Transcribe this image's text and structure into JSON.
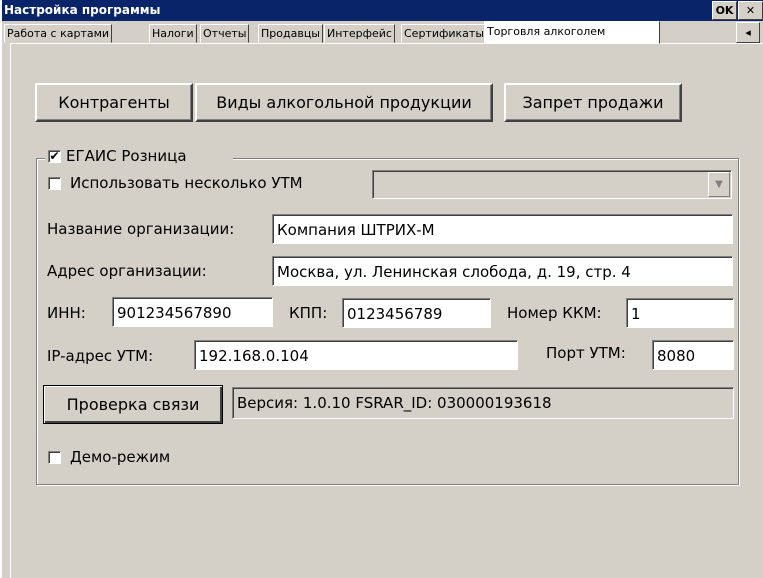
{
  "window": {
    "title": "Настройка программы",
    "ok_label": "OK",
    "close_label": "✕"
  },
  "tabs": [
    {
      "label": "Работа с картами",
      "active": false
    },
    {
      "label": "Налоги",
      "active": false
    },
    {
      "label": "Отчеты",
      "active": false
    },
    {
      "label": "Продавцы",
      "active": false
    },
    {
      "label": "Интерфейс",
      "active": false
    },
    {
      "label": "Сертификаты",
      "active": false
    },
    {
      "label": "Торговля алкоголем",
      "active": true
    }
  ],
  "tab_scroll_left_icon": "◂",
  "buttons": {
    "contractors": "Контрагенты",
    "alcohol_types": "Виды алкогольной продукции",
    "sale_ban": "Запрет продажи",
    "check_connection": "Проверка связи"
  },
  "egais": {
    "group_label": "ЕГАИС Розница",
    "enabled": true,
    "multi_utm_label": "Использовать несколько УТМ",
    "multi_utm_checked": false,
    "multi_utm_select_value": "",
    "org_name_label": "Название организации:",
    "org_name_value": "Компания ШТРИХ-М",
    "org_address_label": "Адрес организации:",
    "org_address_value": "Москва, ул. Ленинская слобода, д. 19, стр. 4",
    "inn_label": "ИНН:",
    "inn_value": "901234567890",
    "kpp_label": "КПП:",
    "kpp_value": "0123456789",
    "kkm_label": "Номер ККМ:",
    "kkm_value": "1",
    "utm_ip_label": "IP-адрес УТМ:",
    "utm_ip_value": "192.168.0.104",
    "utm_port_label": "Порт УТМ:",
    "utm_port_value": "8080",
    "version_text": "Версия: 1.0.10 FSRAR_ID: 030000193618",
    "demo_label": "Демо-режим",
    "demo_checked": false
  },
  "colors": {
    "titlebar": "#0a246a",
    "face": "#d4d0c8"
  }
}
